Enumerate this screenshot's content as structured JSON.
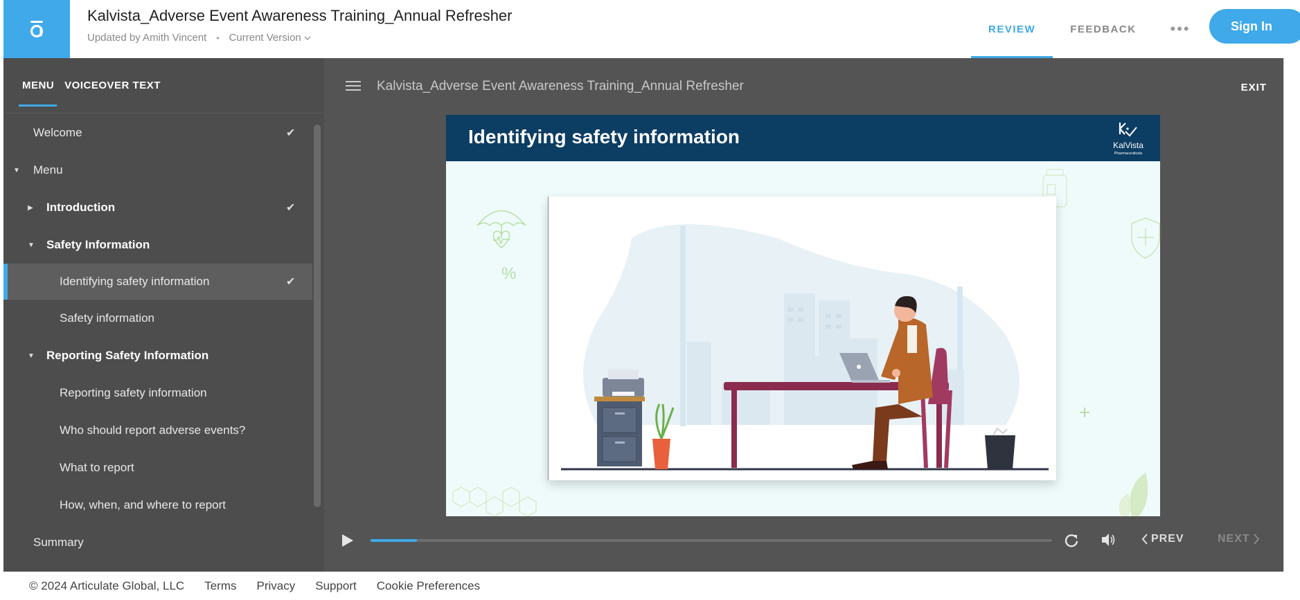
{
  "header": {
    "doc_title": "Kalvista_Adverse Event Awareness Training_Annual Refresher",
    "updated_by": "Updated by Amith Vincent",
    "separator": "•",
    "version": "Current Version",
    "tabs": [
      {
        "label": "REVIEW",
        "active": true
      },
      {
        "label": "FEEDBACK",
        "active": false
      }
    ],
    "more": "•••",
    "sign_in": "Sign In",
    "brand_color": "#3fa9e9"
  },
  "sidebar": {
    "tabs": [
      {
        "label": "MENU",
        "active": true
      },
      {
        "label": "VOICEOVER TEXT",
        "active": false
      }
    ],
    "items": [
      {
        "label": "Welcome",
        "level": 0,
        "checked": true
      },
      {
        "label": "Menu",
        "level": 0,
        "expanded": true
      },
      {
        "label": "Introduction",
        "level": 1,
        "bold": true,
        "expanded": false,
        "checked": true
      },
      {
        "label": "Safety Information",
        "level": 1,
        "bold": true,
        "expanded": true
      },
      {
        "label": "Identifying safety information",
        "level": 2,
        "selected": true,
        "checked": true
      },
      {
        "label": "Safety information",
        "level": 2
      },
      {
        "label": "Reporting Safety Information",
        "level": 1,
        "bold": true,
        "expanded": true
      },
      {
        "label": "Reporting safety information",
        "level": 2
      },
      {
        "label": "Who should report adverse events?",
        "level": 2
      },
      {
        "label": "What to report",
        "level": 2
      },
      {
        "label": "How, when, and where to report",
        "level": 2
      },
      {
        "label": "Summary",
        "level": 0
      }
    ]
  },
  "player": {
    "title": "Kalvista_Adverse Event Awareness Training_Annual Refresher",
    "exit": "EXIT",
    "slide": {
      "title": "Identifying safety information",
      "logo_text": "KalVista",
      "logo_sub": "Pharmaceuticals",
      "header_color": "#0c3d63"
    },
    "progress_fraction": 0.068,
    "prev": "PREV",
    "next": "NEXT"
  },
  "footer": {
    "copyright": "© 2024 Articulate Global, LLC",
    "links": [
      "Terms",
      "Privacy",
      "Support",
      "Cookie Preferences"
    ]
  }
}
